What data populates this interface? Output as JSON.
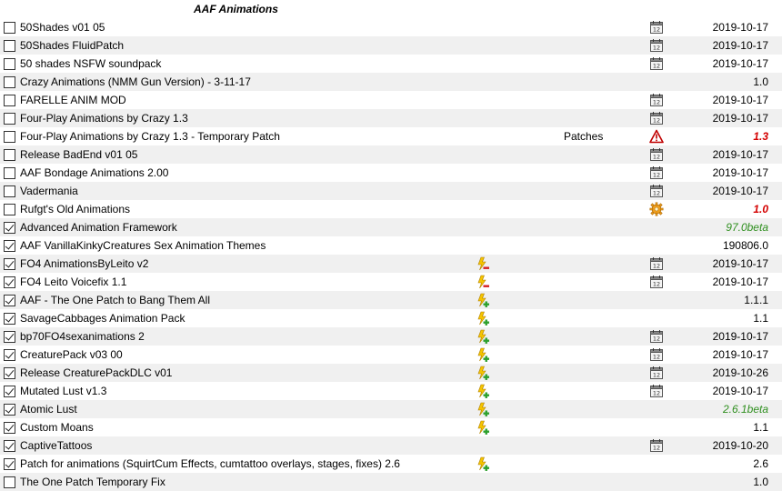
{
  "group": {
    "title": "AAF Animations"
  },
  "colors": {
    "alt_row": "#f0f0f0",
    "warning_red": "#d40000",
    "beta_green": "#2f8f1f"
  },
  "rows": [
    {
      "name": "50Shades v01 05",
      "checked": false,
      "flag": "",
      "category": "",
      "status": "calendar-icon",
      "version": "2019-10-17",
      "vstyle": ""
    },
    {
      "name": "50Shades FluidPatch",
      "checked": false,
      "flag": "",
      "category": "",
      "status": "calendar-icon",
      "version": "2019-10-17",
      "vstyle": ""
    },
    {
      "name": "50 shades NSFW soundpack",
      "checked": false,
      "flag": "",
      "category": "",
      "status": "calendar-icon",
      "version": "2019-10-17",
      "vstyle": ""
    },
    {
      "name": "Crazy Animations (NMM Gun Version) - 3-11-17",
      "checked": false,
      "flag": "",
      "category": "",
      "status": "",
      "version": "1.0",
      "vstyle": ""
    },
    {
      "name": "FARELLE ANIM MOD",
      "checked": false,
      "flag": "",
      "category": "",
      "status": "calendar-icon",
      "version": "2019-10-17",
      "vstyle": ""
    },
    {
      "name": "Four-Play Animations by Crazy 1.3",
      "checked": false,
      "flag": "",
      "category": "",
      "status": "calendar-icon",
      "version": "2019-10-17",
      "vstyle": ""
    },
    {
      "name": "Four-Play Animations by Crazy 1.3 - Temporary Patch",
      "checked": false,
      "flag": "",
      "category": "Patches",
      "status": "warning-icon",
      "version": "1.3",
      "vstyle": "red"
    },
    {
      "name": "Release BadEnd v01 05",
      "checked": false,
      "flag": "",
      "category": "",
      "status": "calendar-icon",
      "version": "2019-10-17",
      "vstyle": ""
    },
    {
      "name": "AAF Bondage Animations 2.00",
      "checked": false,
      "flag": "",
      "category": "",
      "status": "calendar-icon",
      "version": "2019-10-17",
      "vstyle": ""
    },
    {
      "name": "Vadermania",
      "checked": false,
      "flag": "",
      "category": "",
      "status": "calendar-icon",
      "version": "2019-10-17",
      "vstyle": ""
    },
    {
      "name": "Rufgt's Old Animations",
      "checked": false,
      "flag": "",
      "category": "",
      "status": "gear-icon",
      "version": "1.0",
      "vstyle": "red"
    },
    {
      "name": "Advanced Animation Framework",
      "checked": true,
      "flag": "",
      "category": "",
      "status": "",
      "version": "97.0beta",
      "vstyle": "green"
    },
    {
      "name": "AAF VanillaKinkyCreatures Sex Animation Themes",
      "checked": true,
      "flag": "",
      "category": "",
      "status": "",
      "version": "190806.0",
      "vstyle": ""
    },
    {
      "name": "FO4 AnimationsByLeito v2",
      "checked": true,
      "flag": "lightning-minus-icon",
      "category": "",
      "status": "calendar-icon",
      "version": "2019-10-17",
      "vstyle": ""
    },
    {
      "name": "FO4 Leito Voicefix 1.1",
      "checked": true,
      "flag": "lightning-minus-icon",
      "category": "",
      "status": "calendar-icon",
      "version": "2019-10-17",
      "vstyle": ""
    },
    {
      "name": "AAF - The One Patch to Bang Them All",
      "checked": true,
      "flag": "lightning-plus-icon",
      "category": "",
      "status": "",
      "version": "1.1.1",
      "vstyle": ""
    },
    {
      "name": "SavageCabbages Animation Pack",
      "checked": true,
      "flag": "lightning-plus-icon",
      "category": "",
      "status": "",
      "version": "1.1",
      "vstyle": ""
    },
    {
      "name": "bp70FO4sexanimations 2",
      "checked": true,
      "flag": "lightning-plus-icon",
      "category": "",
      "status": "calendar-icon",
      "version": "2019-10-17",
      "vstyle": ""
    },
    {
      "name": "CreaturePack v03 00",
      "checked": true,
      "flag": "lightning-plus-icon",
      "category": "",
      "status": "calendar-icon",
      "version": "2019-10-17",
      "vstyle": ""
    },
    {
      "name": "Release CreaturePackDLC v01",
      "checked": true,
      "flag": "lightning-plus-icon",
      "category": "",
      "status": "calendar-icon",
      "version": "2019-10-26",
      "vstyle": ""
    },
    {
      "name": "Mutated Lust v1.3",
      "checked": true,
      "flag": "lightning-plus-icon",
      "category": "",
      "status": "calendar-icon",
      "version": "2019-10-17",
      "vstyle": ""
    },
    {
      "name": "Atomic Lust",
      "checked": true,
      "flag": "lightning-plus-icon",
      "category": "",
      "status": "",
      "version": "2.6.1beta",
      "vstyle": "green"
    },
    {
      "name": "Custom Moans",
      "checked": true,
      "flag": "lightning-plus-icon",
      "category": "",
      "status": "",
      "version": "1.1",
      "vstyle": ""
    },
    {
      "name": "CaptiveTattoos",
      "checked": true,
      "flag": "",
      "category": "",
      "status": "calendar-icon",
      "version": "2019-10-20",
      "vstyle": ""
    },
    {
      "name": "Patch for animations (SquirtCum Effects, cumtattoo overlays, stages, fixes) 2.6",
      "checked": true,
      "flag": "lightning-plus-icon",
      "category": "",
      "status": "",
      "version": "2.6",
      "vstyle": ""
    },
    {
      "name": "The One Patch Temporary Fix",
      "checked": false,
      "flag": "",
      "category": "",
      "status": "",
      "version": "1.0",
      "vstyle": ""
    }
  ]
}
